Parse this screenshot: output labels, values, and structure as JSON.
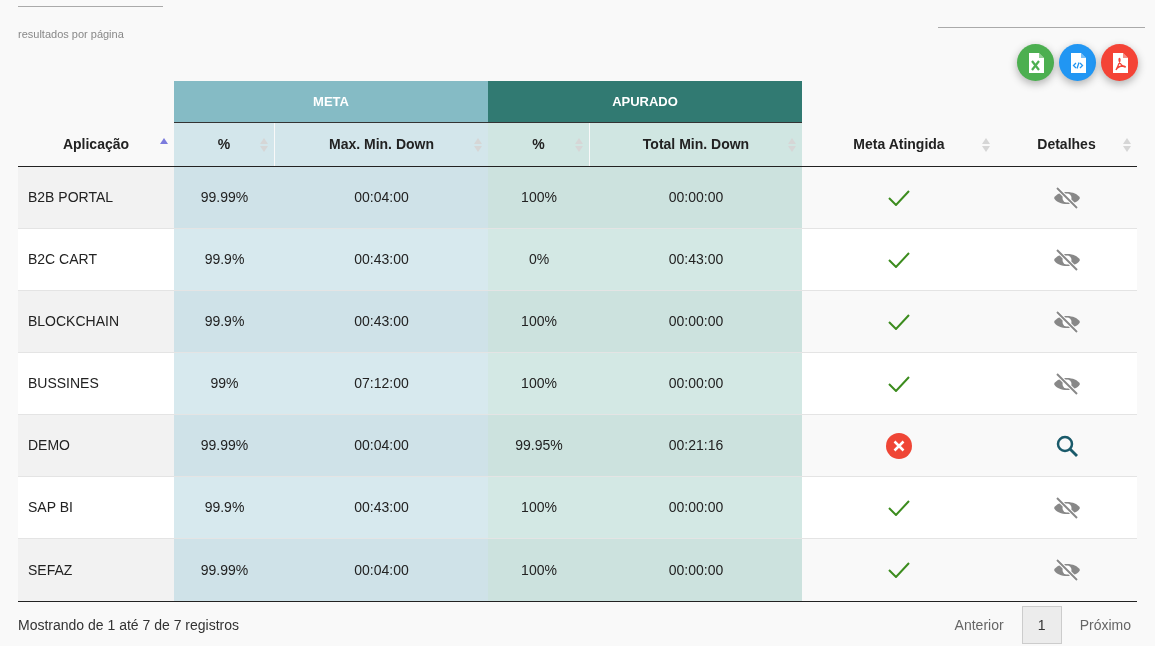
{
  "page_size": {
    "label": "resultados por página"
  },
  "export_buttons": [
    {
      "kind": "excel"
    },
    {
      "kind": "xml"
    },
    {
      "kind": "pdf"
    }
  ],
  "table": {
    "header": [
      {
        "kind": "column",
        "label": "Aplicação",
        "sorted": true
      },
      {
        "kind": "group",
        "label": "META",
        "color": "#85bbc5",
        "columns": [
          {
            "label": "%",
            "sorted": false
          },
          {
            "label": "Max. Min. Down",
            "sorted": false
          }
        ]
      },
      {
        "kind": "group",
        "label": "APURADO",
        "color": "#317a72",
        "columns": [
          {
            "label": "%",
            "sorted": false
          },
          {
            "label": "Total Min. Down",
            "sorted": false
          }
        ]
      },
      {
        "kind": "column",
        "label": "Meta Atingida",
        "sorted": false
      },
      {
        "kind": "column",
        "label": "Detalhes",
        "sorted": false
      }
    ],
    "rows": [
      {
        "app": "B2B PORTAL",
        "meta_pct": "99.99%",
        "max_down": "00:04:00",
        "real_pct": "100%",
        "total_down": "00:00:00",
        "met": true
      },
      {
        "app": "B2C CART",
        "meta_pct": "99.9%",
        "max_down": "00:43:00",
        "real_pct": "0%",
        "total_down": "00:43:00",
        "met": true
      },
      {
        "app": "BLOCKCHAIN",
        "meta_pct": "99.9%",
        "max_down": "00:43:00",
        "real_pct": "100%",
        "total_down": "00:00:00",
        "met": true
      },
      {
        "app": "BUSSINES",
        "meta_pct": "99%",
        "max_down": "07:12:00",
        "real_pct": "100%",
        "total_down": "00:00:00",
        "met": true
      },
      {
        "app": "DEMO",
        "meta_pct": "99.99%",
        "max_down": "00:04:00",
        "real_pct": "99.95%",
        "total_down": "00:21:16",
        "met": false
      },
      {
        "app": "SAP BI",
        "meta_pct": "99.9%",
        "max_down": "00:43:00",
        "real_pct": "100%",
        "total_down": "00:00:00",
        "met": true
      },
      {
        "app": "SEFAZ",
        "meta_pct": "99.99%",
        "max_down": "00:04:00",
        "real_pct": "100%",
        "total_down": "00:00:00",
        "met": true
      }
    ]
  },
  "footer": {
    "info": "Mostrando de 1 até 7 de 7 registros",
    "pagination": [
      {
        "label": "Anterior",
        "kind": "link"
      },
      {
        "label": "1",
        "kind": "page",
        "selected": true
      },
      {
        "label": "Próximo",
        "kind": "link"
      }
    ]
  }
}
